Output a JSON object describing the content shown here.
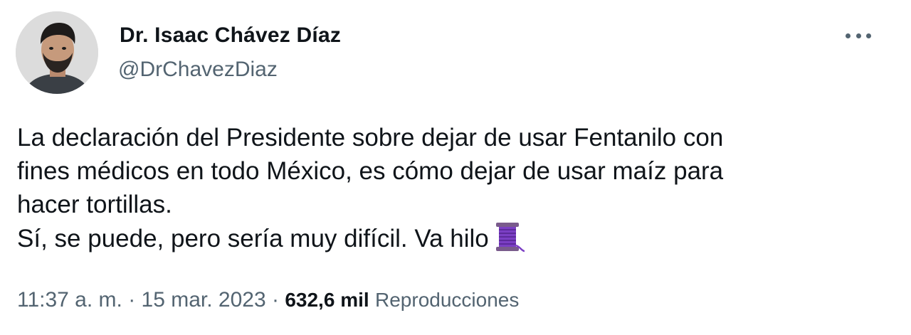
{
  "author": {
    "display_name": "Dr. Isaac Chávez Díaz",
    "handle": "@DrChavezDiaz"
  },
  "tweet": {
    "text_line1": "La declaración del Presidente sobre dejar de usar Fentanilo con",
    "text_line2": "fines médicos en todo México, es cómo dejar de usar maíz para",
    "text_line3": "hacer tortillas.",
    "text_line4": "Sí, se puede, pero sería muy difícil. Va hilo",
    "emoji_icon": "thread-spool-icon"
  },
  "meta": {
    "time": "11:37 a. m.",
    "separator": " · ",
    "date": "15 mar. 2023",
    "views_count": "632,6 mil",
    "views_label": "Reproducciones"
  },
  "colors": {
    "text_primary": "#0f1419",
    "text_secondary": "#536471",
    "spool": "#7b3fc4"
  }
}
